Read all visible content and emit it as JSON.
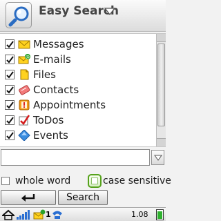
{
  "header": {
    "title": "Easy Search",
    "search_icon": "magnifier-icon",
    "menu_icon": "chevron-down-icon"
  },
  "list": {
    "items": [
      {
        "label": "Messages",
        "checked": true,
        "icon": "envelope-icon"
      },
      {
        "label": "E-mails",
        "checked": true,
        "icon": "email-icon"
      },
      {
        "label": "Files",
        "checked": true,
        "icon": "file-icon"
      },
      {
        "label": "Contacts",
        "checked": true,
        "icon": "contact-card-icon"
      },
      {
        "label": "Appointments",
        "checked": true,
        "icon": "appointment-icon"
      },
      {
        "label": "ToDos",
        "checked": true,
        "icon": "todo-check-icon"
      },
      {
        "label": "Events",
        "checked": true,
        "icon": "event-diamond-icon"
      }
    ]
  },
  "search_field": {
    "value": "",
    "placeholder": ""
  },
  "options": {
    "whole_word_label": "whole word",
    "whole_word_checked": false,
    "case_sensitive_label": "case sensitive",
    "case_sensitive_checked": false
  },
  "buttons": {
    "back_icon": "back-arrow-icon",
    "search_label": "Search"
  },
  "status_bar": {
    "message_count": "1",
    "clock": "1.08",
    "battery_level": 0.8
  },
  "colors": {
    "check_green": "#56a21c",
    "battery_green": "#2fb12f"
  }
}
